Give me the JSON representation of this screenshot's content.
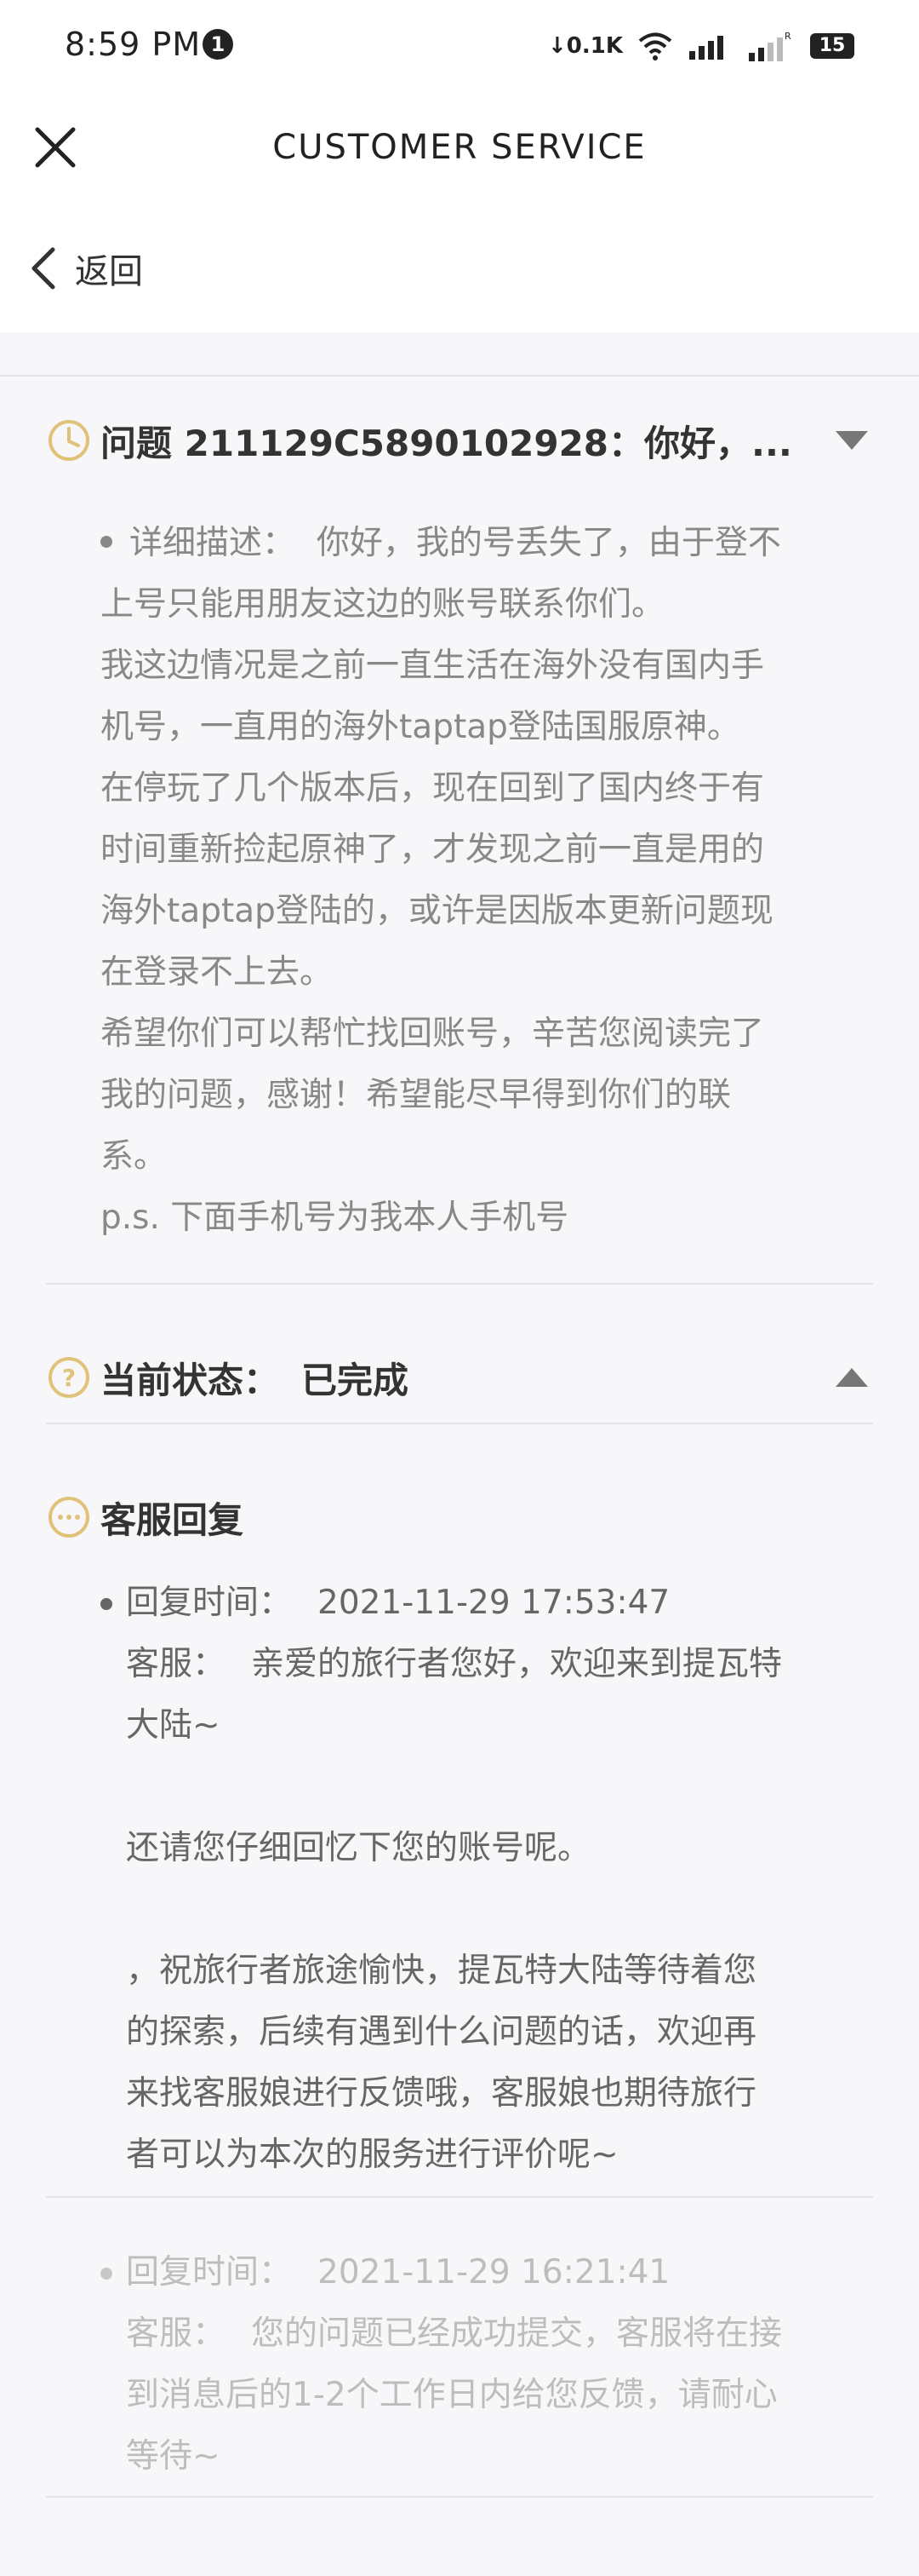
{
  "status_bar": {
    "time": "8:59 PM",
    "notification_count": "1",
    "net_speed": "0.1K",
    "battery": "15"
  },
  "header": {
    "title": "CUSTOMER SERVICE",
    "back_label": "返回"
  },
  "question": {
    "title": "问题 211129C5890102928：你好，...",
    "desc_label": "详细描述：",
    "lines": [
      "你好，我的号丢失了，由于登不",
      "上号只能用朋友这边的账号联系你们。",
      "我这边情况是之前一直生活在海外没有国内手",
      "机号，一直用的海外taptap登陆国服原神。",
      "在停玩了几个版本后，现在回到了国内终于有",
      "时间重新捡起原神了，才发现之前一直是用的",
      "海外taptap登陆的，或许是因版本更新问题现",
      "在登录不上去。",
      "希望你们可以帮忙找回账号，辛苦您阅读完了",
      "我的问题，感谢！希望能尽早得到你们的联",
      "系。",
      "p.s. 下面手机号为我本人手机号"
    ]
  },
  "status": {
    "label": "当前状态：",
    "value": "已完成"
  },
  "replies_section": {
    "title": "客服回复",
    "replies": [
      {
        "time_label": "回复时间：",
        "time": "2021-11-29 17:53:47",
        "agent_label": "客服：",
        "lines": [
          "亲爱的旅行者您好，欢迎来到提瓦特",
          "大陆~",
          "",
          "还请您仔细回忆下您的账号呢。",
          "",
          "，祝旅行者旅途愉快，提瓦特大陆等待着您",
          "的探索，后续有遇到什么问题的话，欢迎再",
          "来找客服娘进行反馈哦，客服娘也期待旅行",
          "者可以为本次的服务进行评价呢~"
        ]
      },
      {
        "time_label": "回复时间：",
        "time": "2021-11-29 16:21:41",
        "agent_label": "客服：",
        "lines": [
          "您的问题已经成功提交，客服将在接",
          "到消息后的1-2个工作日内给您反馈，请耐心",
          "等待~"
        ]
      }
    ]
  },
  "colors": {
    "accent": "#e0c27a",
    "text_dark": "#333333",
    "text_muted": "#888888",
    "divider": "#e4e4e8"
  }
}
